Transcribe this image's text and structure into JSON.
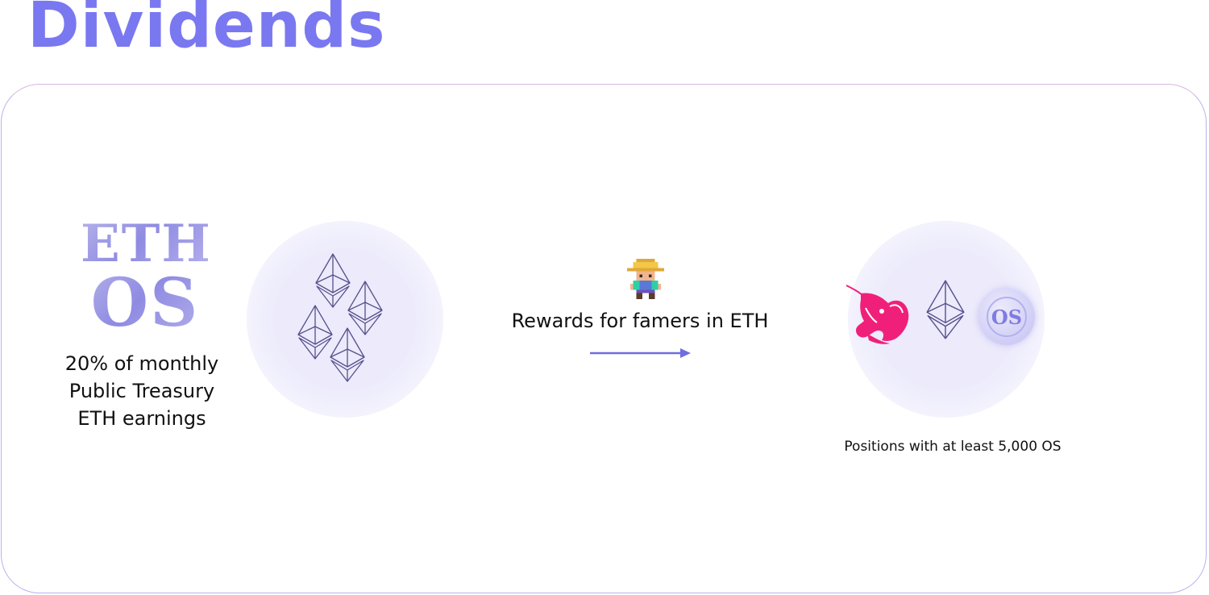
{
  "page": {
    "title": "Dividends"
  },
  "logo": {
    "line1": "ETH",
    "line2": "OS"
  },
  "treasury": {
    "lines": [
      "20% of monthly",
      "Public Treasury",
      "ETH earnings"
    ]
  },
  "rewards": {
    "label": "Rewards for famers in ETH"
  },
  "positions": {
    "label": "Positions with at least 5,000 OS"
  },
  "os_coin": {
    "label": "OS"
  },
  "icons": {
    "eth": "ethereum-icon",
    "farmer": "pixel-farmer-icon",
    "arrow": "arrow-right-icon",
    "uniswap": "uniswap-unicorn-icon",
    "os": "os-coin-icon"
  },
  "colors": {
    "title": "#7a78f0",
    "accent": "#6f6ce0",
    "halo": "#eceafb",
    "uniswap": "#f0207a",
    "text": "#111111"
  }
}
